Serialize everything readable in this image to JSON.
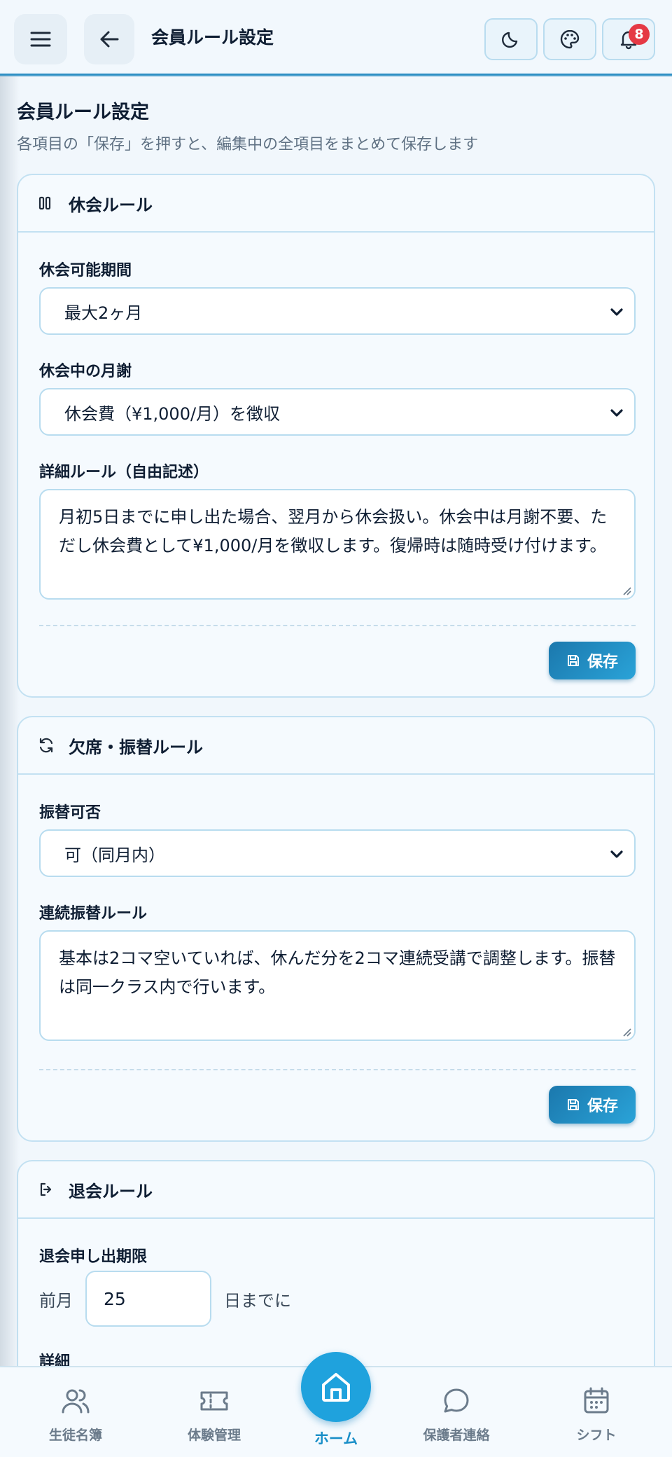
{
  "header": {
    "title": "会員ルール設定",
    "notification_count": "8",
    "icons": [
      "menu-icon",
      "back-arrow-icon",
      "moon-icon",
      "palette-icon",
      "bell-icon"
    ]
  },
  "page": {
    "title": "会員ルール設定",
    "subtitle": "各項目の「保存」を押すと、編集中の全項目をまとめて保存します"
  },
  "suspension": {
    "title": "休会ルール",
    "period_label": "休会可能期間",
    "period_value": "最大2ヶ月",
    "fee_label": "休会中の月謝",
    "fee_value": "休会費（¥1,000/月）を徴収",
    "detail_label": "詳細ルール（自由記述）",
    "detail_value": "月初5日までに申し出た場合、翌月から休会扱い。休会中は月謝不要、ただし休会費として¥1,000/月を徴収します。復帰時は随時受け付けます。",
    "save_label": "保存"
  },
  "makeup": {
    "title": "欠席・振替ルール",
    "allow_label": "振替可否",
    "allow_value": "可（同月内）",
    "consecutive_label": "連続振替ルール",
    "consecutive_value": "基本は2コマ空いていれば、休んだ分を2コマ連続受講で調整します。振替は同一クラス内で行います。",
    "save_label": "保存"
  },
  "withdrawal": {
    "title": "退会ルール",
    "deadline_label": "退会申し出期限",
    "prefix": "前月",
    "day_value": "25",
    "suffix": "日までに",
    "detail_label": "詳細"
  },
  "bottom_nav": {
    "students": "生徒名簿",
    "trial": "体験管理",
    "home": "ホーム",
    "parents": "保護者連絡",
    "shift": "シフト"
  },
  "colors": {
    "accent": "#1fa2dd",
    "header_border": "#2e8fc4",
    "badge": "#e53944",
    "card_border": "#c3e1f2"
  }
}
